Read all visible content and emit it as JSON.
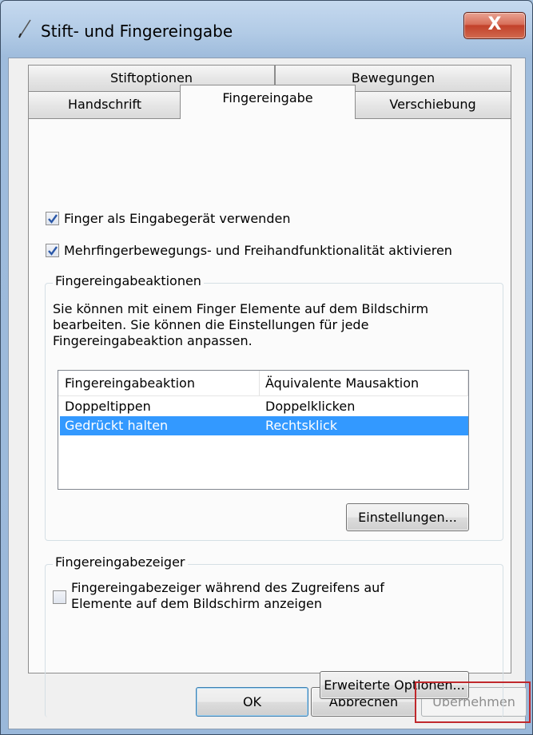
{
  "window": {
    "title": "Stift- und Fingereingabe",
    "close_glyph": "X"
  },
  "tabs": {
    "row1": [
      "Stiftoptionen",
      "Bewegungen"
    ],
    "row2": [
      "Handschrift",
      "Fingereingabe",
      "Verschiebung"
    ],
    "selected": "Fingereingabe"
  },
  "checkboxes": {
    "use_finger": {
      "label": "Finger als Eingabegerät verwenden",
      "checked": true
    },
    "multitouch": {
      "label": "Mehrfingerbewegungs- und Freihandfunktionalität aktivieren",
      "checked": true
    }
  },
  "actions_group": {
    "title": "Fingereingabeaktionen",
    "description": [
      "Sie können mit einem Finger Elemente auf dem Bildschirm",
      "bearbeiten. Sie können die Einstellungen für jede",
      "Fingereingabeaktion anpassen."
    ],
    "columns": [
      "Fingereingabeaktion",
      "Äquivalente Mausaktion"
    ],
    "rows": [
      {
        "action": "Doppeltippen",
        "mouse": "Doppelklicken",
        "selected": false
      },
      {
        "action": "Gedrückt halten",
        "mouse": "Rechtsklick",
        "selected": true
      }
    ],
    "settings_button": "Einstellungen..."
  },
  "pointer_group": {
    "title": "Fingereingabezeiger",
    "checkbox": {
      "label_lines": [
        "Fingereingabezeiger während des Zugreifens auf",
        "Elemente auf dem Bildschirm anzeigen"
      ],
      "checked": false
    },
    "advanced_button": "Erweiterte Optionen..."
  },
  "footer": {
    "ok": "OK",
    "cancel": "Abbrechen",
    "apply": "Übernehmen"
  },
  "colors": {
    "selection": "#3399ff",
    "highlight_box": "#c0282c",
    "checkmark": "#2b58a8"
  }
}
